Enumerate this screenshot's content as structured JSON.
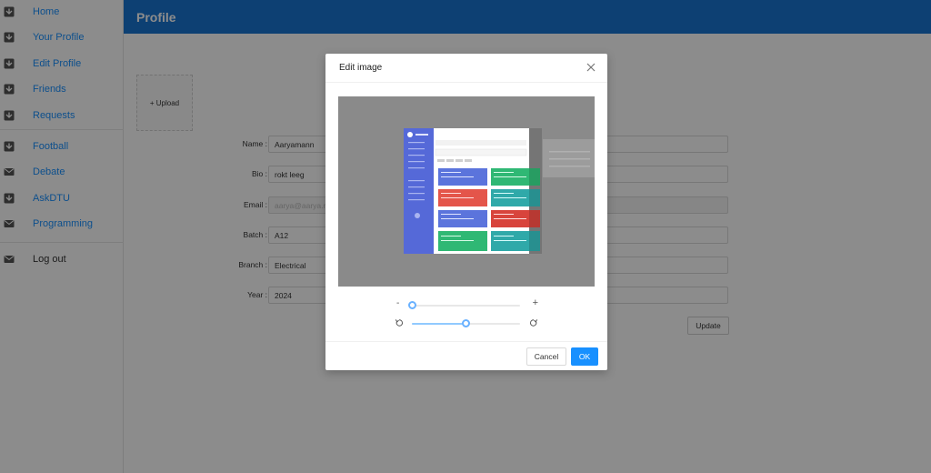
{
  "sidebar": {
    "items": [
      {
        "label": "Home",
        "icon": "inbox-icon"
      },
      {
        "label": "Your Profile",
        "icon": "inbox-icon"
      },
      {
        "label": "Edit Profile",
        "icon": "inbox-icon"
      },
      {
        "label": "Friends",
        "icon": "inbox-icon"
      },
      {
        "label": "Requests",
        "icon": "inbox-icon"
      },
      {
        "label": "Football",
        "icon": "inbox-icon"
      },
      {
        "label": "Debate",
        "icon": "mail-icon"
      },
      {
        "label": "AskDTU",
        "icon": "inbox-icon"
      },
      {
        "label": "Programming",
        "icon": "mail-icon"
      },
      {
        "label": "Log out",
        "icon": "mail-icon"
      }
    ]
  },
  "header": {
    "title": "Profile"
  },
  "form": {
    "upload_label": "+ Upload",
    "fields": [
      {
        "label": "Name :",
        "value": "Aaryamann"
      },
      {
        "label": "Bio :",
        "value": "rokt leeg"
      },
      {
        "label": "Email :",
        "value": "aarya@aarya.r"
      },
      {
        "label": "Batch :",
        "value": "A12"
      },
      {
        "label": "Branch :",
        "value": "Electrical"
      },
      {
        "label": "Year :",
        "value": "2024"
      }
    ],
    "update_label": "Update"
  },
  "modal": {
    "title": "Edit image",
    "zoom_minus": "-",
    "zoom_plus": "+",
    "zoom_level": 0.0,
    "rotation_level": 0.5,
    "cancel_label": "Cancel",
    "ok_label": "OK"
  },
  "colors": {
    "accent": "#1890ff",
    "header": "#1976d2"
  }
}
